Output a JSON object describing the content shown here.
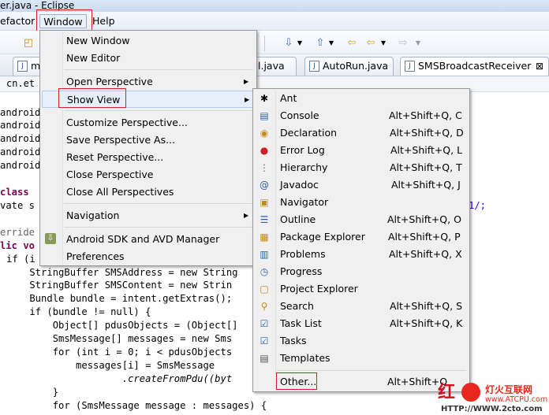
{
  "window_title": "er.java - Eclipse",
  "menubar": {
    "refactor": "efactor",
    "window": "Window",
    "help": "Help"
  },
  "tabs": [
    {
      "label": "m"
    },
    {
      "label": "l.java"
    },
    {
      "label": "AutoRun.java"
    },
    {
      "label": "SMSBroadcastReceiver",
      "close": "⊠"
    }
  ],
  "breadcrumb": "cn.et",
  "code_lines": [
    "android",
    "android",
    "android",
    "android",
    "android",
    "class",
    "vate s",
    "erride",
    "lic vo",
    "if (i",
    "    StringBuffer SMSAddress = new String",
    "    StringBuffer SMSContent = new Strin",
    "    Bundle bundle = intent.getExtras();",
    "    if (bundle != null) {",
    "        Object[] pdusObjects = (Object[]",
    "        SmsMessage[] messages = new Sms",
    "        for (int i = 0; i < pdusObjects",
    "            messages[i] = SmsMessage",
    "                    .createFromPdu((byt",
    "        }",
    "        for (SmsMessage message : messages) {"
  ],
  "right_fragment": "1/;",
  "window_menu": {
    "items": [
      {
        "label": "New Window",
        "arrow": false
      },
      {
        "label": "New Editor",
        "arrow": false
      },
      {
        "label": "Open Perspective",
        "arrow": true
      },
      {
        "label": "Show View",
        "arrow": true
      },
      {
        "label": "Customize Perspective...",
        "arrow": false
      },
      {
        "label": "Save Perspective As...",
        "arrow": false
      },
      {
        "label": "Reset Perspective...",
        "arrow": false
      },
      {
        "label": "Close Perspective",
        "arrow": false
      },
      {
        "label": "Close All Perspectives",
        "arrow": false
      },
      {
        "label": "Navigation",
        "arrow": true
      },
      {
        "label": "Android SDK and AVD Manager",
        "arrow": false
      },
      {
        "label": "Preferences",
        "arrow": false
      }
    ]
  },
  "show_view_menu": {
    "items": [
      {
        "label": "Ant",
        "shortcut": "",
        "icon": "ant-icon"
      },
      {
        "label": "Console",
        "shortcut": "Alt+Shift+Q, C",
        "icon": "console-icon"
      },
      {
        "label": "Declaration",
        "shortcut": "Alt+Shift+Q, D",
        "icon": "declaration-icon"
      },
      {
        "label": "Error Log",
        "shortcut": "Alt+Shift+Q, L",
        "icon": "error-log-icon"
      },
      {
        "label": "Hierarchy",
        "shortcut": "Alt+Shift+Q, T",
        "icon": "hierarchy-icon"
      },
      {
        "label": "Javadoc",
        "shortcut": "Alt+Shift+Q, J",
        "icon": "javadoc-icon"
      },
      {
        "label": "Navigator",
        "shortcut": "",
        "icon": "navigator-icon"
      },
      {
        "label": "Outline",
        "shortcut": "Alt+Shift+Q, O",
        "icon": "outline-icon"
      },
      {
        "label": "Package Explorer",
        "shortcut": "Alt+Shift+Q, P",
        "icon": "package-explorer-icon"
      },
      {
        "label": "Problems",
        "shortcut": "Alt+Shift+Q, X",
        "icon": "problems-icon"
      },
      {
        "label": "Progress",
        "shortcut": "",
        "icon": "progress-icon"
      },
      {
        "label": "Project Explorer",
        "shortcut": "",
        "icon": "project-explorer-icon"
      },
      {
        "label": "Search",
        "shortcut": "Alt+Shift+Q, S",
        "icon": "search-icon"
      },
      {
        "label": "Task List",
        "shortcut": "Alt+Shift+Q, K",
        "icon": "task-list-icon"
      },
      {
        "label": "Tasks",
        "shortcut": "",
        "icon": "tasks-icon"
      },
      {
        "label": "Templates",
        "shortcut": "",
        "icon": "templates-icon"
      },
      {
        "label": "Other...",
        "shortcut": "Alt+Shift+Q",
        "icon": ""
      }
    ]
  },
  "watermark": {
    "name": "灯火互联网",
    "url": "www.ATCPU.com",
    "bg_url": "HTTP://WWW.2cto.com"
  },
  "colors": {
    "highlight_box": "#d0202a",
    "keyword": "#7f0055",
    "menu_bg": "#f0f0f0"
  }
}
